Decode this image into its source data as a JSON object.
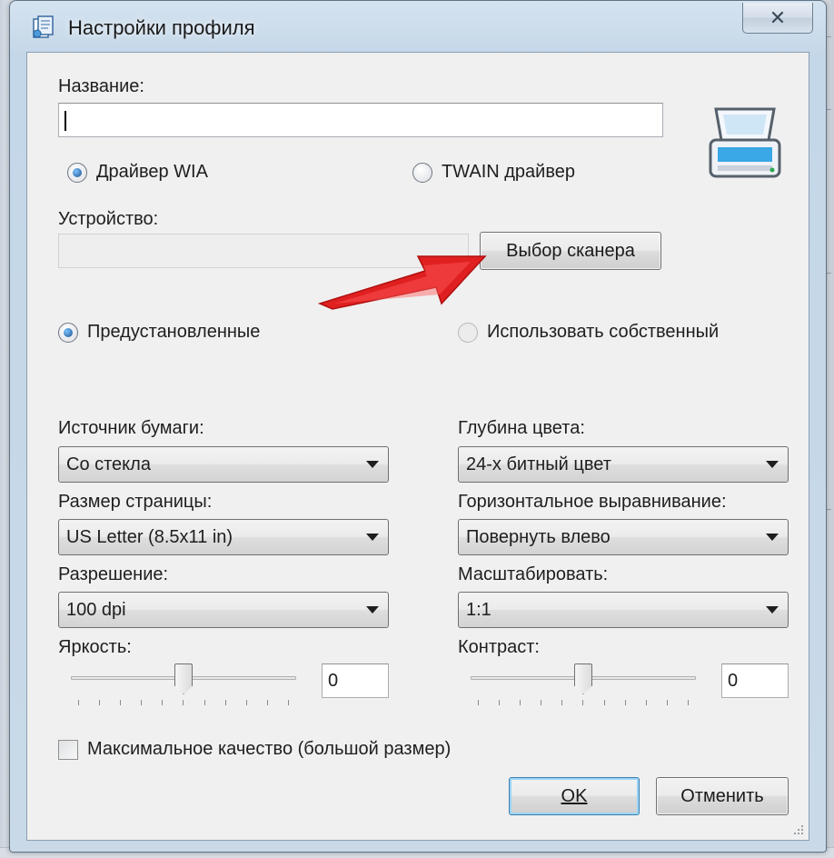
{
  "window": {
    "title": "Настройки профиля",
    "close_label": "✕"
  },
  "form": {
    "name_label": "Название:",
    "name_value": "",
    "driver_options": [
      {
        "label": "Драйвер WIA",
        "checked": true
      },
      {
        "label": "TWAIN драйвер",
        "checked": false
      }
    ],
    "device_label": "Устройство:",
    "device_value": "",
    "select_scanner_button": "Выбор сканера",
    "preset_options": [
      {
        "label": "Предустановленные",
        "checked": true
      },
      {
        "label": "Использовать собственный",
        "checked": false,
        "disabled": true
      }
    ],
    "paper_source": {
      "label": "Источник бумаги:",
      "value": "Со стекла"
    },
    "color_depth": {
      "label": "Глубина цвета:",
      "value": "24-х битный цвет"
    },
    "page_size": {
      "label": "Размер страницы:",
      "value": "US Letter (8.5x11 in)"
    },
    "horizontal_align": {
      "label": "Горизонтальное выравнивание:",
      "value": "Повернуть влево"
    },
    "resolution": {
      "label": "Разрешение:",
      "value": "100 dpi"
    },
    "scale": {
      "label": "Масштабировать:",
      "value": "1:1"
    },
    "brightness": {
      "label": "Яркость:",
      "value": "0",
      "slider_fraction": 0.5
    },
    "contrast": {
      "label": "Контраст:",
      "value": "0",
      "slider_fraction": 0.5
    },
    "max_quality_label": "Максимальное качество (большой размер)",
    "max_quality_checked": false
  },
  "buttons": {
    "ok_label": "OK",
    "cancel_label": "Отменить"
  },
  "icons": {
    "title": "document-settings-icon",
    "scanner": "scanner-icon",
    "annotation": "red-arrow-icon"
  },
  "colors": {
    "arrow": "#e02020",
    "frame": "#c4d7e8",
    "client": "#f0f0f0"
  }
}
